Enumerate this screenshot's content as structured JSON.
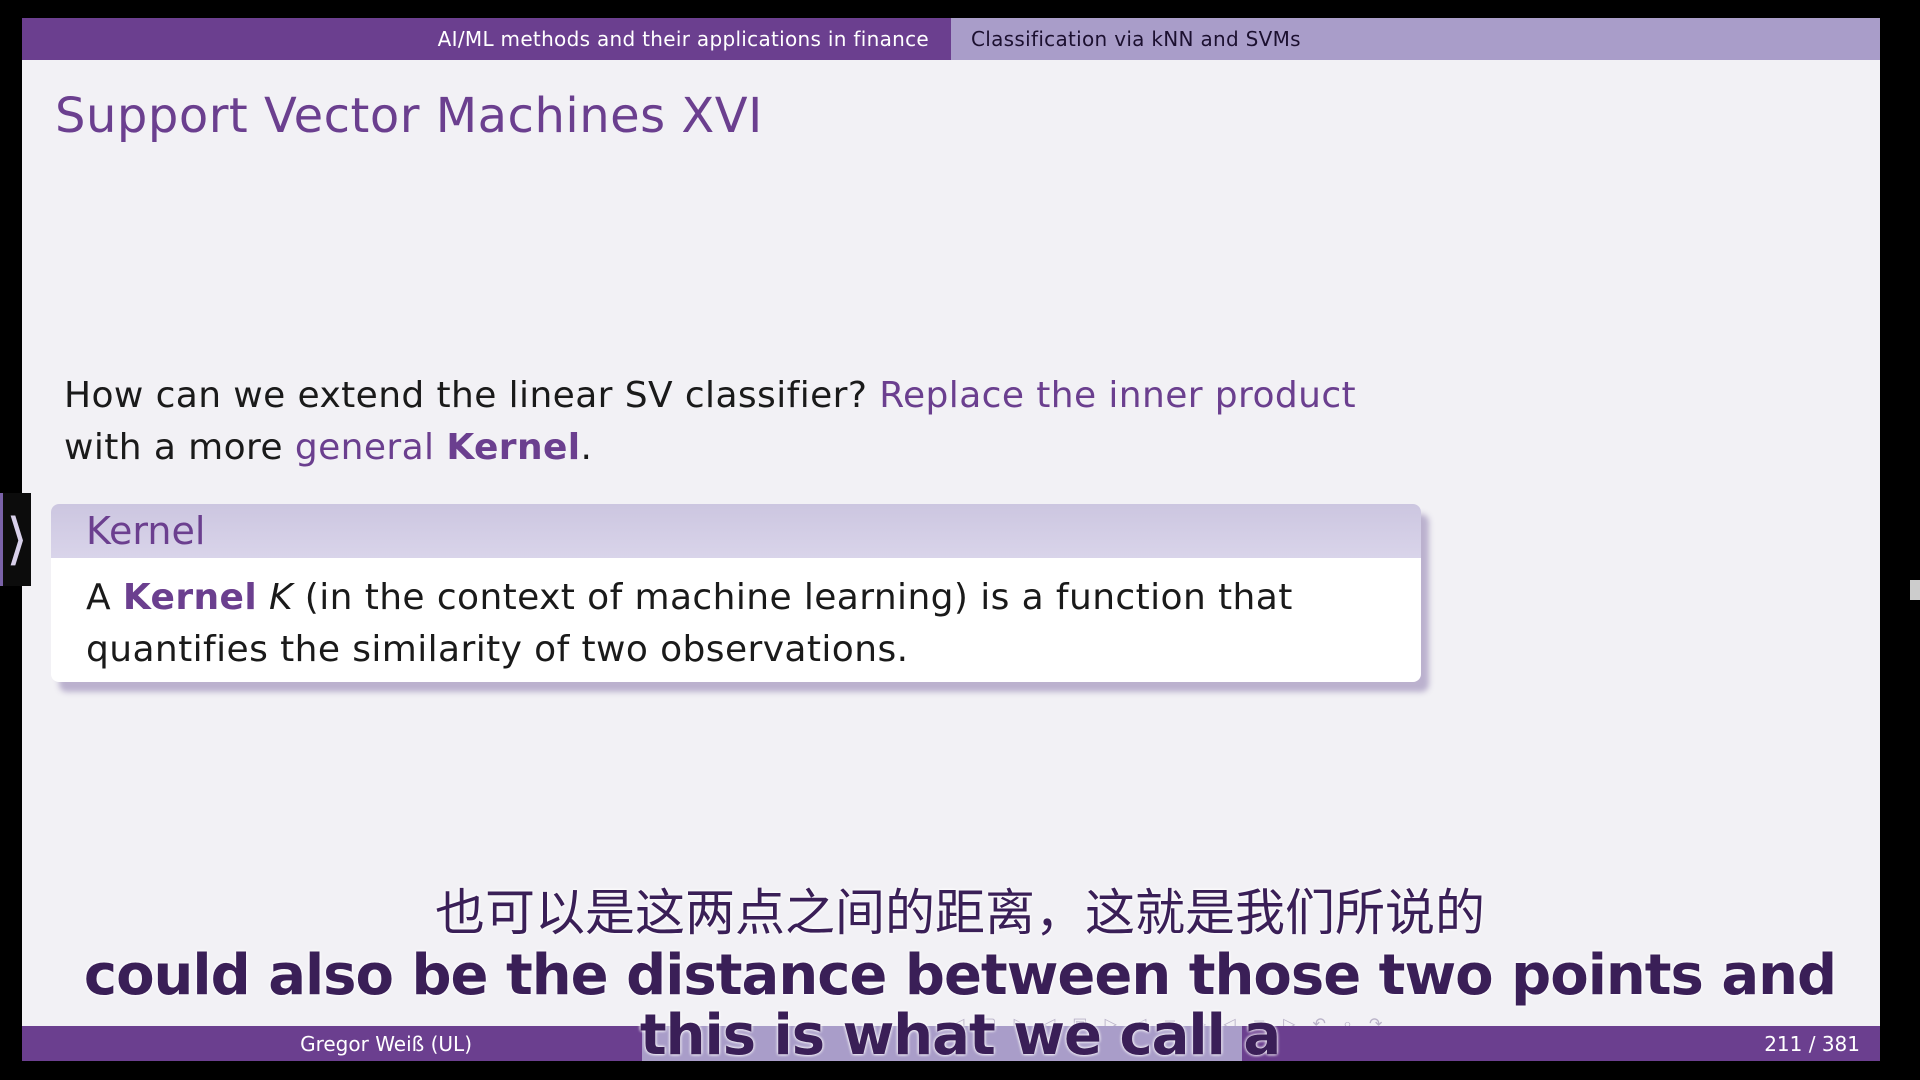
{
  "header": {
    "section_left": "AI/ML methods and their applications in finance",
    "section_right": "Classification via kNN and SVMs"
  },
  "slide": {
    "title": "Support Vector Machines XVI",
    "para": {
      "p1": "How can we extend the linear SV classifier?",
      "p2": "Replace the inner product",
      "p3": "with a more",
      "p4": "general",
      "p5": "Kernel",
      "p6": "."
    },
    "block": {
      "title": "Kernel",
      "b1": "A",
      "b2": "Kernel",
      "b3": "K",
      "b4": "(in the context of machine learning) is a function that quantifies the similarity of two observations."
    }
  },
  "footer": {
    "author": "Gregor Weiß (UL)",
    "page": "211 / 381"
  },
  "subtitles": {
    "zh": "也可以是这两点之间的距离，这就是我们所说的",
    "en1": "could also be the distance between those two points and",
    "en2": "this is what we call a"
  },
  "icons": {
    "sidebar_toggle": "chevron-right-icon",
    "nav": "beamer-navigation-icons"
  }
}
